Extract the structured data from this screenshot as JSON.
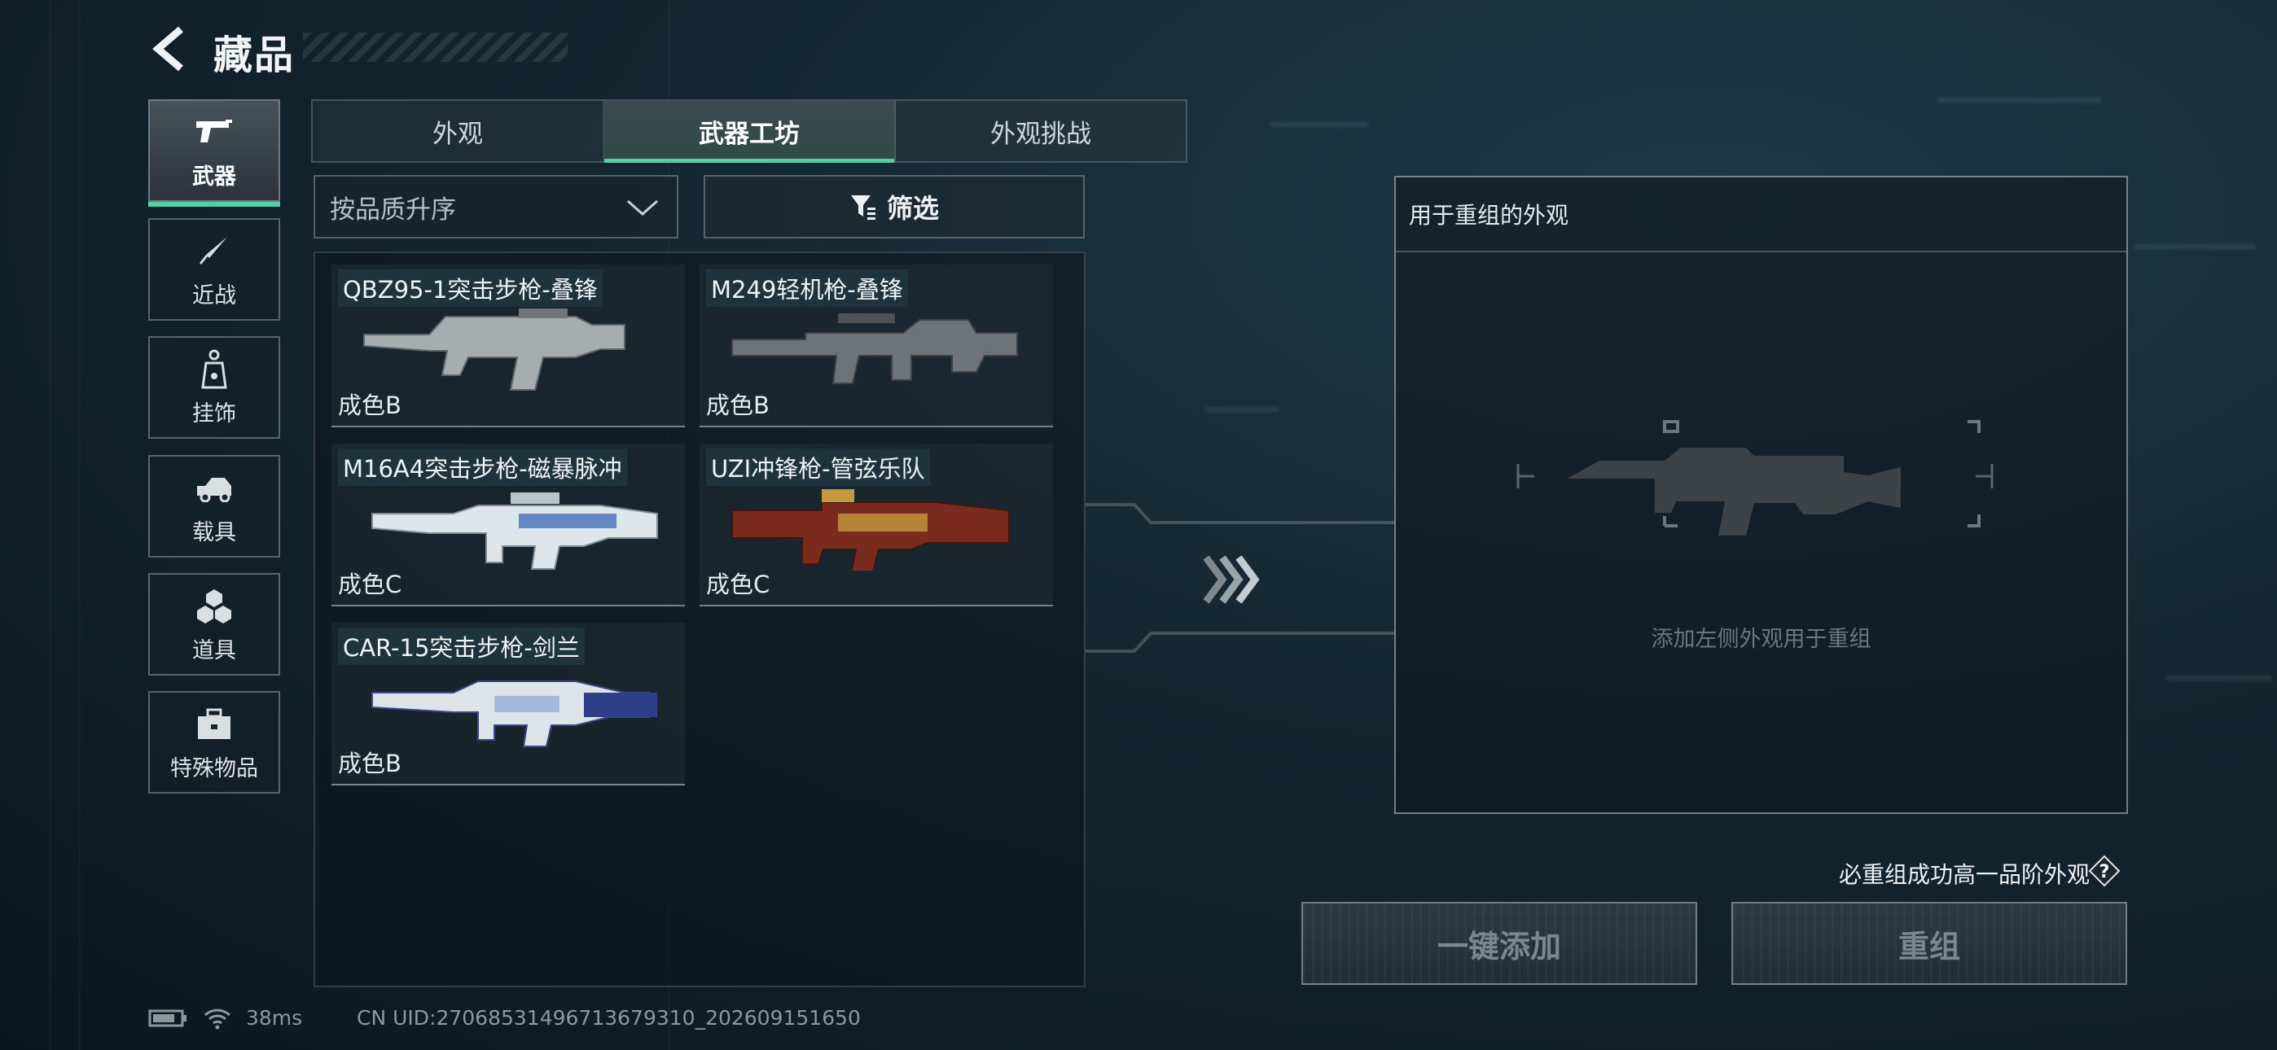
{
  "header": {
    "title": "藏品"
  },
  "sidebar": {
    "items": [
      {
        "label": "武器",
        "icon": "pistol-icon",
        "active": true
      },
      {
        "label": "近战",
        "icon": "knife-icon"
      },
      {
        "label": "挂饰",
        "icon": "charm-icon"
      },
      {
        "label": "载具",
        "icon": "car-icon"
      },
      {
        "label": "道具",
        "icon": "cubes-icon"
      },
      {
        "label": "特殊物品",
        "icon": "toolbox-icon"
      }
    ]
  },
  "tabs": [
    {
      "label": "外观"
    },
    {
      "label": "武器工坊",
      "active": true
    },
    {
      "label": "外观挑战"
    }
  ],
  "controls": {
    "sort_label": "按品质升序",
    "filter_label": "筛选"
  },
  "items": [
    {
      "name": "QBZ95-1突击步枪-叠锋",
      "grade": "成色B"
    },
    {
      "name": "M249轻机枪-叠锋",
      "grade": "成色B"
    },
    {
      "name": "M16A4突击步枪-磁暴脉冲",
      "grade": "成色C"
    },
    {
      "name": "UZI冲锋枪-管弦乐队",
      "grade": "成色C"
    },
    {
      "name": "CAR-15突击步枪-剑兰",
      "grade": "成色B"
    }
  ],
  "recombine": {
    "header": "用于重组的外观",
    "hint": "添加左侧外观用于重组",
    "guarantee": "必重组成功高一品阶外观",
    "add_all_label": "一键添加",
    "recombine_label": "重组"
  },
  "status": {
    "ping": "38ms",
    "uid": "CN UID:27068531496713679310_202609151650"
  },
  "colors": {
    "accent": "#55d0a6"
  }
}
